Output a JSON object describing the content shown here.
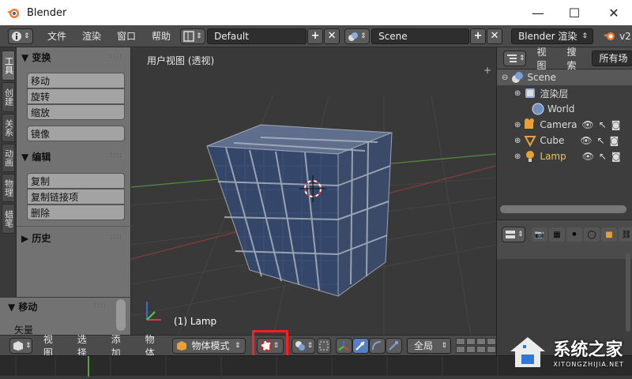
{
  "window": {
    "title": "Blender",
    "minimize": "—",
    "maximize": "☐",
    "close": "✕"
  },
  "menu": {
    "items": [
      "文件",
      "渲染",
      "窗口",
      "帮助"
    ]
  },
  "layout": {
    "value": "Default"
  },
  "scene": {
    "value": "Scene"
  },
  "engine": {
    "value": "Blender 渲染",
    "version": "v2"
  },
  "tabs": [
    "工具",
    "创建",
    "关系",
    "动画",
    "物理",
    "蜡笔"
  ],
  "tools": {
    "transform_header": "▼ 变换",
    "transform": [
      "移动",
      "旋转",
      "缩放"
    ],
    "mirror": "镜像",
    "edit_header": "▼ 编辑",
    "edit": [
      "复制",
      "复制链接项",
      "删除"
    ],
    "history": "▶ 历史"
  },
  "operator": {
    "header": "▼ 移动",
    "field": "矢量"
  },
  "viewport": {
    "label": "用户视图 (透视)",
    "object": "(1) Lamp",
    "plus": "+"
  },
  "v3dheader": {
    "menus": [
      "视图",
      "选择",
      "添加",
      "物体"
    ],
    "mode": "物体模式",
    "global": "全局"
  },
  "outliner": {
    "view": "视图",
    "search": "搜索",
    "all": "所有场",
    "items": [
      {
        "label": "Scene",
        "icon": "scene-icon"
      },
      {
        "label": "渲染层",
        "icon": "render-layer-icon"
      },
      {
        "label": "World",
        "icon": "world-icon"
      },
      {
        "label": "Camera",
        "icon": "camera-icon"
      },
      {
        "label": "Cube",
        "icon": "mesh-icon"
      },
      {
        "label": "Lamp",
        "icon": "lamp-icon"
      }
    ]
  },
  "watermark": {
    "title": "系统之家",
    "url": "XITONGZHIJIA.NET"
  },
  "colors": {
    "accent_red": "#ff1f1f",
    "selected_blue": "#5680c2",
    "cube_blue": "#3b4d6f"
  }
}
